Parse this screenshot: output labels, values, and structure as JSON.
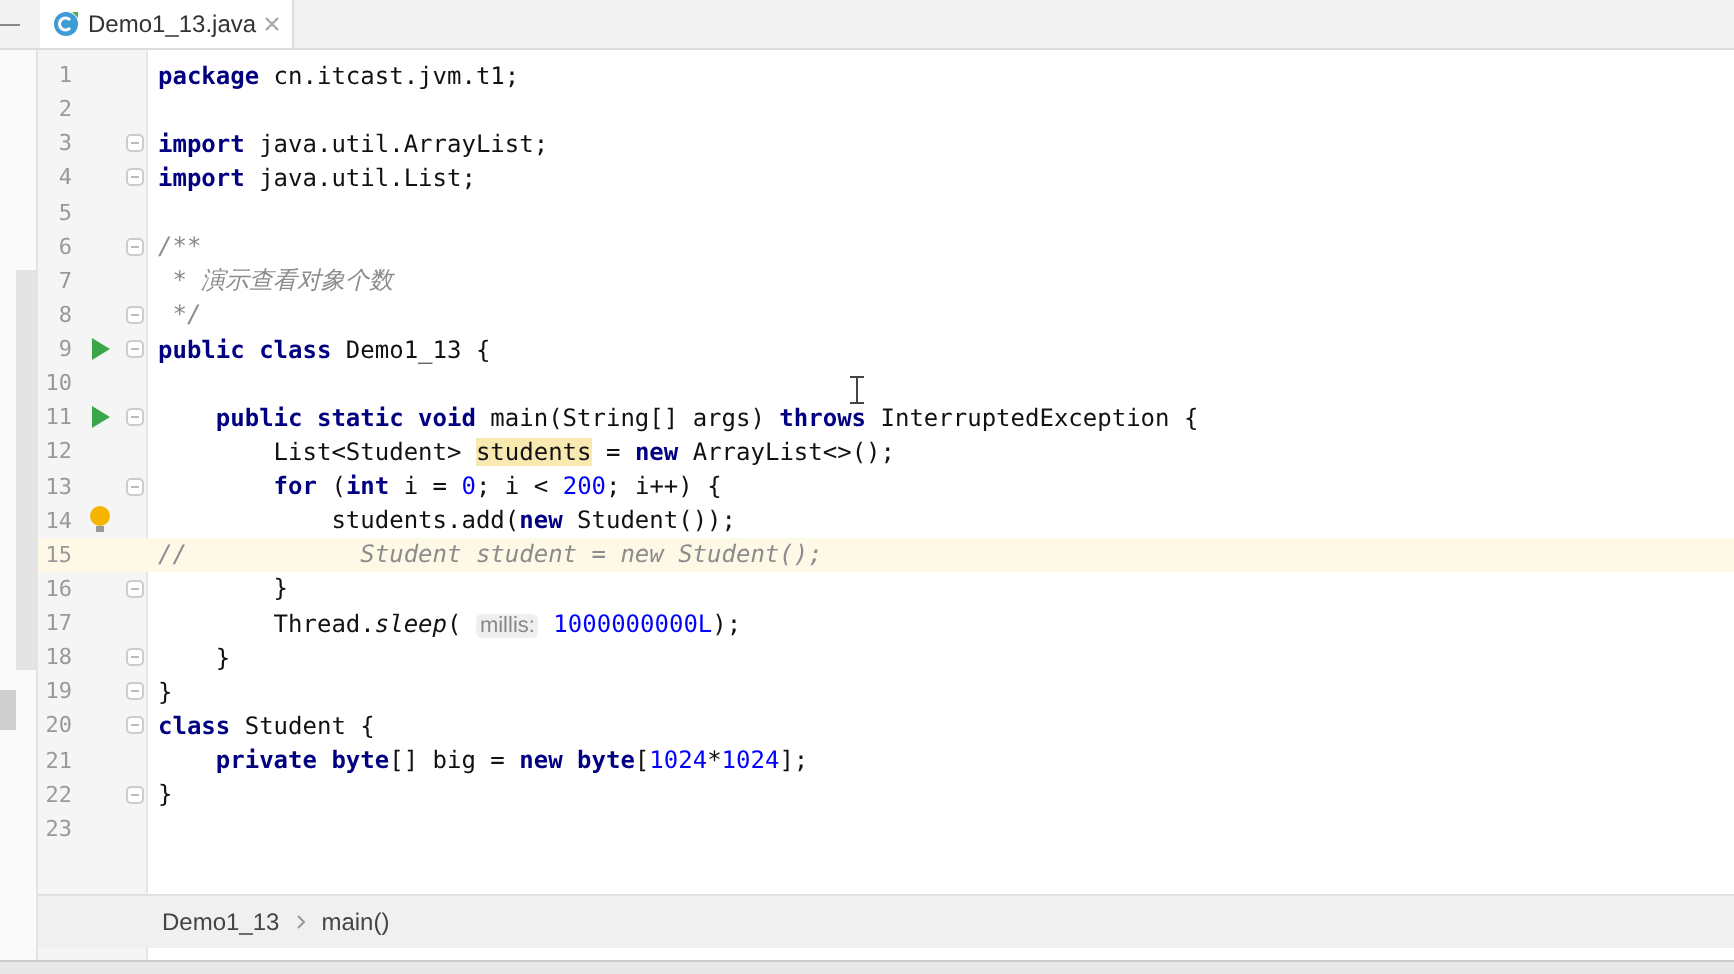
{
  "tabs": [
    {
      "label": "Demo1_13.java",
      "selected": true
    }
  ],
  "lines": [
    {
      "number": "1",
      "tokens": [
        {
          "kind": "kw",
          "text": "package"
        },
        {
          "kind": "plain",
          "text": " cn.itcast.jvm.t1;"
        }
      ]
    },
    {
      "number": "2"
    },
    {
      "number": "3",
      "fold": true,
      "tokens": [
        {
          "kind": "kw",
          "text": "import"
        },
        {
          "kind": "plain",
          "text": " java.util.ArrayList;"
        }
      ]
    },
    {
      "number": "4",
      "fold": true,
      "tokens": [
        {
          "kind": "kw",
          "text": "import"
        },
        {
          "kind": "plain",
          "text": " java.util.List;"
        }
      ]
    },
    {
      "number": "5"
    },
    {
      "number": "6",
      "fold": true,
      "tokens": [
        {
          "kind": "comment",
          "text": "/**"
        }
      ]
    },
    {
      "number": "7",
      "tokens": [
        {
          "kind": "comment",
          "text": " * 演示查看对象个数"
        }
      ]
    },
    {
      "number": "8",
      "fold": true,
      "tokens": [
        {
          "kind": "comment",
          "text": " */"
        }
      ]
    },
    {
      "number": "9",
      "run": true,
      "fold": true,
      "tokens": [
        {
          "kind": "kw",
          "text": "public class"
        },
        {
          "kind": "plain",
          "text": " Demo1_13 {"
        }
      ]
    },
    {
      "number": "10"
    },
    {
      "number": "11",
      "run": true,
      "fold": true,
      "tokens": [
        {
          "kind": "kw",
          "text": "    public static void"
        },
        {
          "kind": "plain",
          "text": " main(String[] args) "
        },
        {
          "kind": "kw",
          "text": "throws"
        },
        {
          "kind": "plain",
          "text": " InterruptedException {"
        }
      ]
    },
    {
      "number": "12",
      "tokens": [
        {
          "kind": "plain",
          "text": "        List<Student> "
        },
        {
          "kind": "highlight",
          "text": "students"
        },
        {
          "kind": "plain",
          "text": " = "
        },
        {
          "kind": "kw",
          "text": "new"
        },
        {
          "kind": "plain",
          "text": " ArrayList<>();"
        }
      ]
    },
    {
      "number": "13",
      "fold": true,
      "tokens": [
        {
          "kind": "kw",
          "text": "        for"
        },
        {
          "kind": "plain",
          "text": " ("
        },
        {
          "kind": "kw",
          "text": "int"
        },
        {
          "kind": "plain",
          "text": " i = "
        },
        {
          "kind": "num",
          "text": "0"
        },
        {
          "kind": "plain",
          "text": "; i < "
        },
        {
          "kind": "num",
          "text": "200"
        },
        {
          "kind": "plain",
          "text": "; i++) {"
        }
      ]
    },
    {
      "number": "14",
      "bulb": true,
      "tokens": [
        {
          "kind": "plain",
          "text": "            students.add("
        },
        {
          "kind": "kw",
          "text": "new"
        },
        {
          "kind": "plain",
          "text": " Student());"
        }
      ]
    },
    {
      "number": "15",
      "current": true,
      "tokens": [
        {
          "kind": "comment",
          "text": "//            Student student = new Student();"
        }
      ]
    },
    {
      "number": "16",
      "fold": true,
      "tokens": [
        {
          "kind": "plain",
          "text": "        }"
        }
      ]
    },
    {
      "number": "17",
      "tokens": [
        {
          "kind": "plain",
          "text": "        Thread."
        },
        {
          "kind": "method",
          "text": "sleep"
        },
        {
          "kind": "plain",
          "text": "( "
        },
        {
          "kind": "hint",
          "text": "millis:"
        },
        {
          "kind": "num",
          "text": " 1000000000L"
        },
        {
          "kind": "plain",
          "text": ");"
        }
      ]
    },
    {
      "number": "18",
      "fold": true,
      "tokens": [
        {
          "kind": "plain",
          "text": "    }"
        }
      ]
    },
    {
      "number": "19",
      "fold": true,
      "tokens": [
        {
          "kind": "plain",
          "text": "}"
        }
      ]
    },
    {
      "number": "20",
      "fold": true,
      "tokens": [
        {
          "kind": "kw",
          "text": "class"
        },
        {
          "kind": "plain",
          "text": " Student {"
        }
      ]
    },
    {
      "number": "21",
      "tokens": [
        {
          "kind": "kw",
          "text": "    private byte"
        },
        {
          "kind": "plain",
          "text": "[] big = "
        },
        {
          "kind": "kw",
          "text": "new byte"
        },
        {
          "kind": "plain",
          "text": "["
        },
        {
          "kind": "num",
          "text": "1024"
        },
        {
          "kind": "plain",
          "text": "*"
        },
        {
          "kind": "num",
          "text": "1024"
        },
        {
          "kind": "plain",
          "text": "];"
        }
      ]
    },
    {
      "number": "22",
      "fold": true,
      "tokens": [
        {
          "kind": "plain",
          "text": "}"
        }
      ]
    },
    {
      "number": "23"
    }
  ],
  "breadcrumbs": [
    "Demo1_13",
    "main()"
  ]
}
